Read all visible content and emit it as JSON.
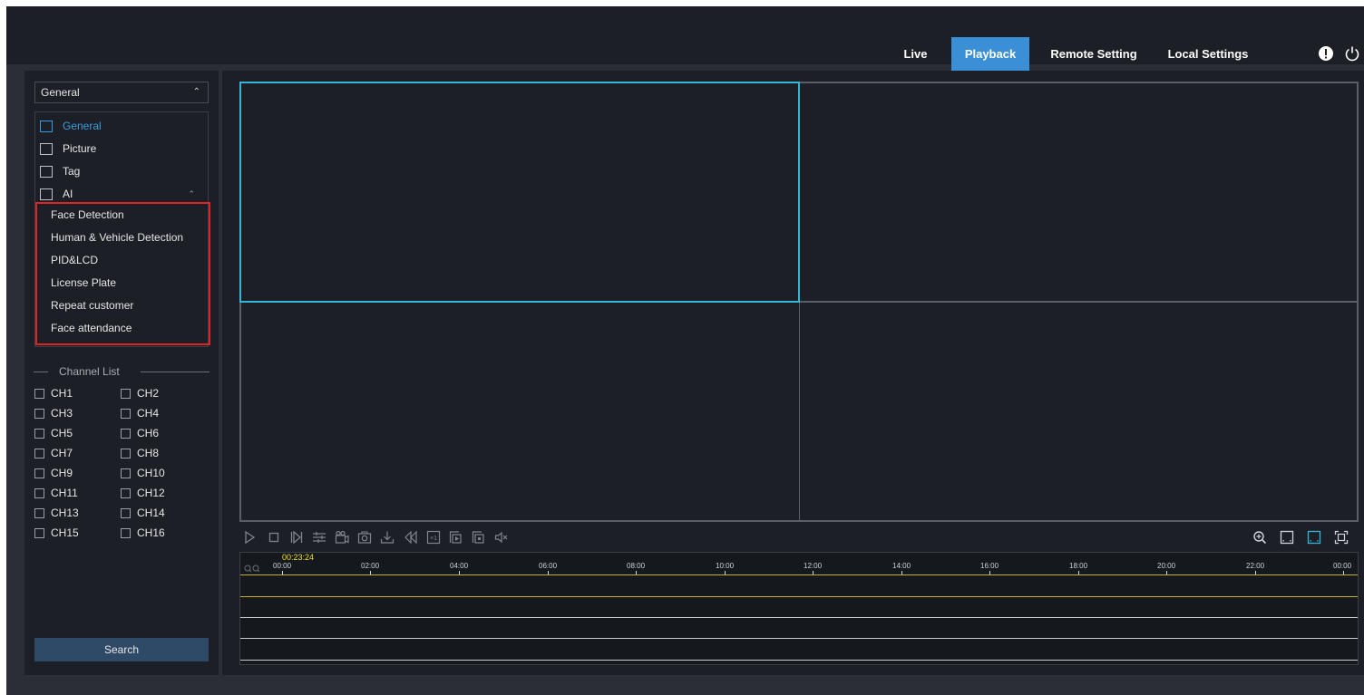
{
  "nav": {
    "tabs": [
      {
        "label": "Live"
      },
      {
        "label": "Playback"
      },
      {
        "label": "Remote Setting"
      },
      {
        "label": "Local Settings"
      }
    ],
    "active": "Playback",
    "icons": [
      "alert-icon",
      "power-icon"
    ]
  },
  "sidebar": {
    "search_type": {
      "value": "General"
    },
    "dropdown": {
      "items": [
        {
          "label": "General",
          "icon": "general-icon"
        },
        {
          "label": "Picture",
          "icon": "picture-icon"
        },
        {
          "label": "Tag",
          "icon": "tag-icon"
        },
        {
          "label": "AI",
          "icon": "ai-icon"
        }
      ],
      "ai_sub_items": [
        "Face Detection",
        "Human & Vehicle Detection",
        "PID&LCD",
        "License Plate",
        "Repeat customer",
        "Face attendance"
      ]
    },
    "channel_list_title": "Channel List",
    "channels": [
      "CH1",
      "CH2",
      "CH3",
      "CH4",
      "CH5",
      "CH6",
      "CH7",
      "CH8",
      "CH9",
      "CH10",
      "CH11",
      "CH12",
      "CH13",
      "CH14",
      "CH15",
      "CH16"
    ],
    "search_label": "Search"
  },
  "timeline": {
    "current_time": "00:23:24",
    "hours": [
      "00:00",
      "02:00",
      "04:00",
      "06:00",
      "08:00",
      "10:00",
      "12:00",
      "14:00",
      "16:00",
      "18:00",
      "20:00",
      "22:00",
      "00:00"
    ]
  },
  "colors": {
    "accent": "#3a8fd6",
    "selected_cell": "#35b6d8",
    "highlight_box": "#e02424",
    "current_time": "#f0e030"
  }
}
